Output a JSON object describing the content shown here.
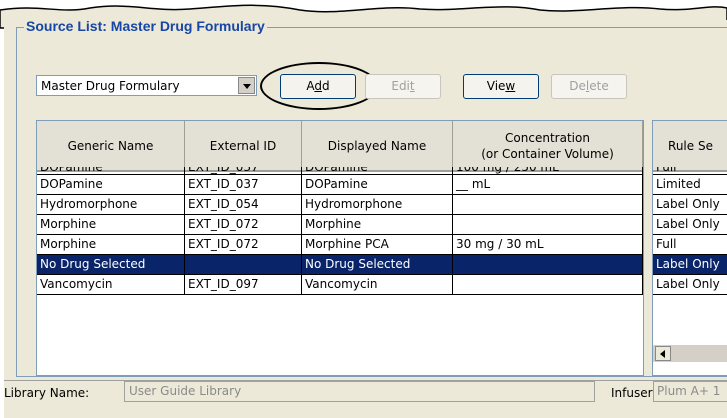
{
  "group": {
    "title": "Source List: Master Drug Formulary"
  },
  "source_select": {
    "value": "Master Drug Formulary"
  },
  "buttons": {
    "add": {
      "label_pre": "A",
      "label_u": "d",
      "label_post": "d"
    },
    "edit": {
      "label_pre": "Edi",
      "label_u": "t",
      "label_post": ""
    },
    "view": {
      "label_pre": "Vie",
      "label_u": "w",
      "label_post": ""
    },
    "delete": {
      "label_pre": "De",
      "label_u": "l",
      "label_post": "ete"
    }
  },
  "table": {
    "columns": [
      {
        "line1": "Generic Name",
        "line2": ""
      },
      {
        "line1": "External ID",
        "line2": ""
      },
      {
        "line1": "Displayed Name",
        "line2": ""
      },
      {
        "line1": "Concentration",
        "line2": "(or Container Volume)"
      }
    ],
    "partial_row": [
      "DOPamine",
      "EXT_ID_037",
      "DOPamine",
      "100 mg / 250 mL"
    ],
    "rows": [
      [
        "DOPamine",
        "EXT_ID_037",
        "DOPamine",
        "__ mL"
      ],
      [
        "Hydromorphone",
        "EXT_ID_054",
        "Hydromorphone",
        ""
      ],
      [
        "Morphine",
        "EXT_ID_072",
        "Morphine",
        ""
      ],
      [
        "Morphine",
        "EXT_ID_072",
        "Morphine PCA",
        "30 mg / 30 mL"
      ],
      [
        "No Drug Selected",
        "",
        "No Drug Selected",
        ""
      ],
      [
        "Vancomycin",
        "EXT_ID_097",
        "Vancomycin",
        ""
      ]
    ],
    "selected_row": 4
  },
  "rule_panel": {
    "header": "Rule Se",
    "partial_value": "Full",
    "values": [
      "Limited",
      "Label Only",
      "Label Only",
      "Full",
      "Label Only",
      "Label Only"
    ]
  },
  "footer": {
    "library_label": "Library Name:",
    "library_value": "User Guide Library",
    "infuser_label": "Infuser:",
    "infuser_value": "Plum A+ 1"
  },
  "colors": {
    "selection": "#0a246a",
    "group_title": "#1646a6"
  }
}
